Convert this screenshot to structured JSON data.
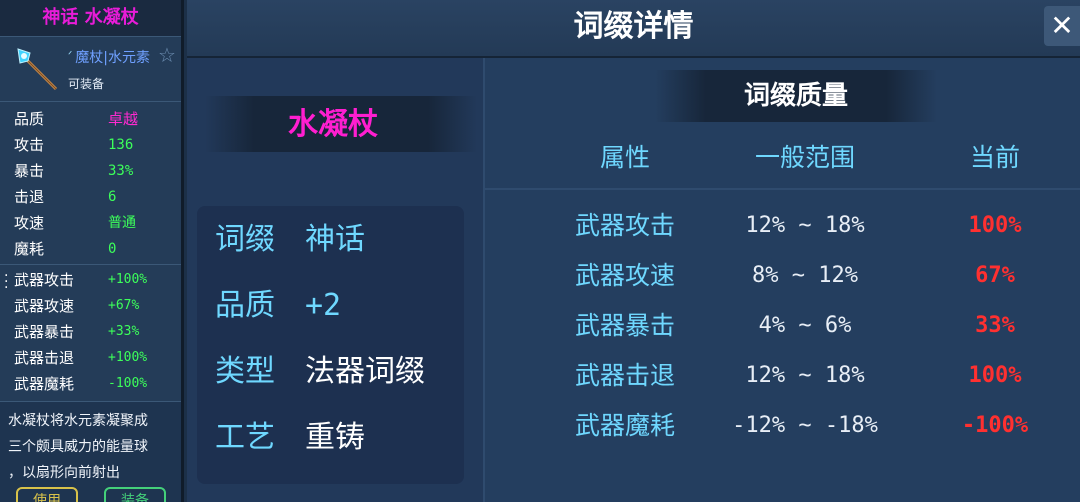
{
  "card": {
    "title": "神话 水凝杖",
    "class_label": "魔杖|水元素",
    "equip_status": "可装备",
    "stats": [
      {
        "label": "品质",
        "value": "卓越"
      },
      {
        "label": "攻击",
        "value": "136"
      },
      {
        "label": "暴击",
        "value": "33%"
      },
      {
        "label": "击退",
        "value": "6"
      },
      {
        "label": "攻速",
        "value": "普通"
      },
      {
        "label": "魔耗",
        "value": "0"
      }
    ],
    "affixes": [
      {
        "label": "武器攻击",
        "value": "+100%"
      },
      {
        "label": "武器攻速",
        "value": "+67%"
      },
      {
        "label": "武器暴击",
        "value": "+33%"
      },
      {
        "label": "武器击退",
        "value": "+100%"
      },
      {
        "label": "武器魔耗",
        "value": "-100%"
      }
    ],
    "description_lines": [
      "水凝杖将水元素凝聚成",
      "三个颇具威力的能量球",
      "，以扇形向前射出"
    ],
    "button_left": "使用",
    "button_right": "装备"
  },
  "header": {
    "title": "词缀详情",
    "close_icon": "close-icon"
  },
  "left": {
    "item_name": "水凝杖",
    "info": [
      {
        "label": "词缀",
        "value": "神话"
      },
      {
        "label": "品质",
        "value": "+2"
      },
      {
        "label": "类型",
        "value": "法器词缀"
      },
      {
        "label": "工艺",
        "value": "重铸"
      }
    ]
  },
  "quality": {
    "title": "词缀质量",
    "columns": [
      "属性",
      "一般范围",
      "当前"
    ],
    "rows": [
      {
        "attr": "武器攻击",
        "range": "12% ~ 18%",
        "current": "100%"
      },
      {
        "attr": "武器攻速",
        "range": "8% ~ 12%",
        "current": "67%"
      },
      {
        "attr": "武器暴击",
        "range": "4% ~ 6%",
        "current": "33%"
      },
      {
        "attr": "武器击退",
        "range": "12% ~ 18%",
        "current": "100%"
      },
      {
        "attr": "武器魔耗",
        "range": "-12% ~ -18%",
        "current": "-100%"
      }
    ]
  },
  "colors": {
    "mythic": "#ff1ed0",
    "attribute": "#6fd8ff",
    "bonus": "#3cff5a",
    "current_value": "#ff3030"
  }
}
